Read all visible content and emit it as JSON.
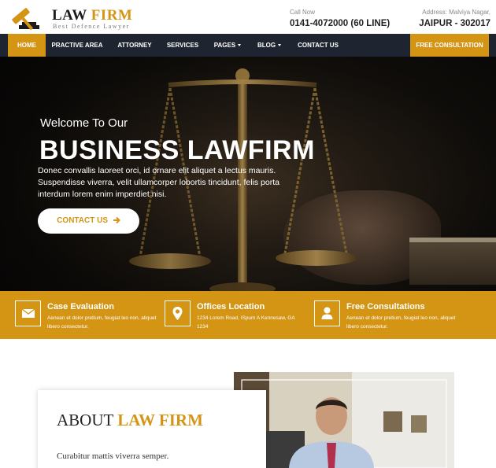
{
  "brand": {
    "name_part1": "LAW",
    "name_part2": "FIRM",
    "tagline": "Best Defence Lawyer",
    "logo_icon": "gavel-icon",
    "accent_color": "#d49514",
    "dark_color": "#1f2530"
  },
  "contact": {
    "call_label": "Call Now",
    "call_value": "0141-4072000 (60 LINE)",
    "address_label": "Address: Malviya Nagar,",
    "address_value": "JAIPUR - 302017"
  },
  "nav": {
    "items": [
      {
        "label": "HOME",
        "active": true
      },
      {
        "label": "PRACTIVE AREA"
      },
      {
        "label": "ATTORNEY"
      },
      {
        "label": "SERVICES"
      },
      {
        "label": "PAGES",
        "dropdown": true
      },
      {
        "label": "BLOG",
        "dropdown": true
      },
      {
        "label": "CONTACT US"
      }
    ],
    "cta_label": "FREE CONSULTATION"
  },
  "hero": {
    "welcome": "Welcome To Our",
    "title": "BUSINESS LAWFIRM",
    "description": "Donec convallis laoreet orci, id ornare elit aliquet a lectus mauris. Suspendisse viverra, velit ullamcorper lobortis tincidunt, felis porta interdum lorem enim imperdiet nisi.",
    "button_label": "CONTACT US",
    "button_icon": "arrow-right-icon"
  },
  "features": [
    {
      "icon": "envelope-icon",
      "title": "Case Evaluation",
      "text": "Aenean et dolor pretium, feugiat leo non, aliquet libero consectetur."
    },
    {
      "icon": "map-pin-icon",
      "title": "Offices Location",
      "text": "1234 Lorem Road, ISpum A Kennesaw, GA 1234"
    },
    {
      "icon": "user-icon",
      "title": "Free Consultations",
      "text": "Aenean et dolor pretium, feugiat leo non, aliquet libero consectetur."
    }
  ],
  "about": {
    "title_part1": "ABOUT",
    "title_part2": "LAW FIRM",
    "text": "Curabitur mattis viverra semper."
  }
}
